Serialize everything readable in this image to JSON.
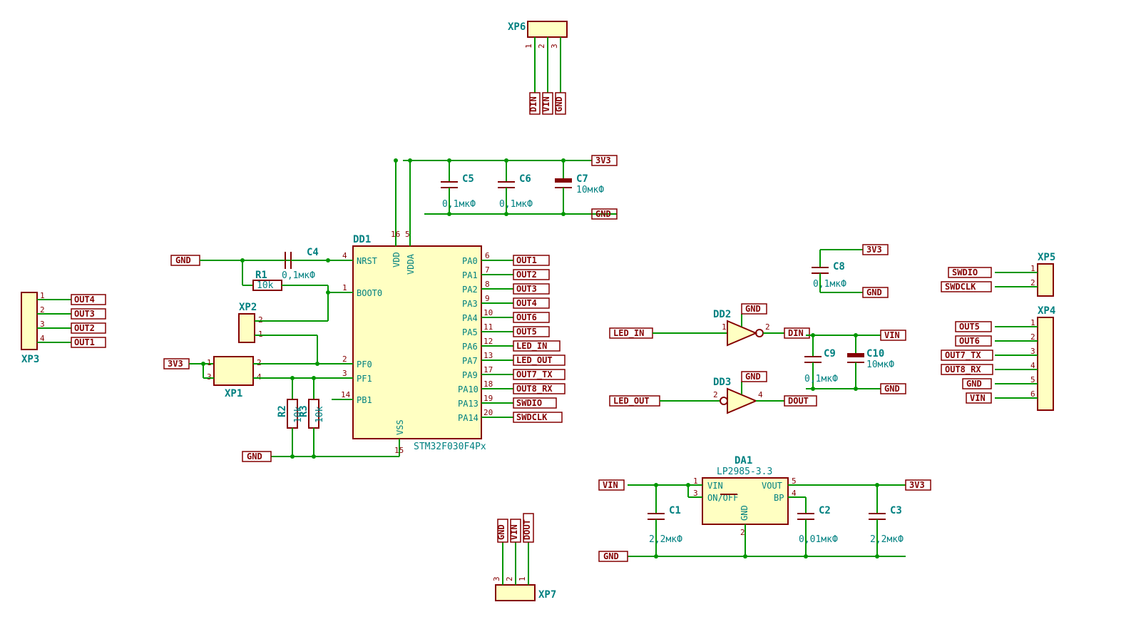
{
  "mcu": {
    "ref": "DD1",
    "value": "STM32F030F4Px",
    "left": [
      {
        "num": "4",
        "name": "NRST"
      },
      {
        "num": "1",
        "name": "BOOT0"
      },
      {
        "num": "2",
        "name": "PF0"
      },
      {
        "num": "3",
        "name": "PF1"
      },
      {
        "num": "14",
        "name": "PB1"
      }
    ],
    "right": [
      {
        "num": "6",
        "name": "PA0",
        "net": "OUT1"
      },
      {
        "num": "7",
        "name": "PA1",
        "net": "OUT2"
      },
      {
        "num": "8",
        "name": "PA2",
        "net": "OUT3"
      },
      {
        "num": "9",
        "name": "PA3",
        "net": "OUT4"
      },
      {
        "num": "10",
        "name": "PA4",
        "net": "OUT6"
      },
      {
        "num": "11",
        "name": "PA5",
        "net": "OUT5"
      },
      {
        "num": "12",
        "name": "PA6",
        "net": "LED_IN"
      },
      {
        "num": "13",
        "name": "PA7",
        "net": "LED_OUT"
      },
      {
        "num": "17",
        "name": "PA9",
        "net": "OUT7_TX"
      },
      {
        "num": "18",
        "name": "PA10",
        "net": "OUT8_RX"
      },
      {
        "num": "19",
        "name": "PA13",
        "net": "SWDIO"
      },
      {
        "num": "20",
        "name": "PA14",
        "net": "SWDCLK"
      }
    ],
    "top": [
      {
        "num": "16",
        "name": "VDD"
      },
      {
        "num": "5",
        "name": "VDDA"
      }
    ],
    "bot": [
      {
        "num": "15",
        "name": "VSS"
      }
    ]
  },
  "caps": {
    "c1": {
      "ref": "C1",
      "val": "2,2мкФ"
    },
    "c2": {
      "ref": "C2",
      "val": "0,01мкФ"
    },
    "c3": {
      "ref": "C3",
      "val": "2,2мкФ"
    },
    "c4": {
      "ref": "C4",
      "val": "0,1мкФ"
    },
    "c5": {
      "ref": "C5",
      "val": "0,1мкФ"
    },
    "c6": {
      "ref": "C6",
      "val": "0,1мкФ"
    },
    "c7": {
      "ref": "C7",
      "val": "10мкФ"
    },
    "c8": {
      "ref": "C8",
      "val": "0,1мкФ"
    },
    "c9": {
      "ref": "C9",
      "val": "0,1мкФ"
    },
    "c10": {
      "ref": "C10",
      "val": "10мкФ"
    }
  },
  "res": {
    "r1": {
      "ref": "R1",
      "val": "10k"
    },
    "r2": {
      "ref": "R2",
      "val": "10k"
    },
    "r3": {
      "ref": "R3",
      "val": "10k"
    }
  },
  "reg": {
    "ref": "DA1",
    "val": "LP2985-3.3",
    "pins": {
      "vin": "VIN",
      "onoff": "ON/OFF",
      "gnd": "GND",
      "bp": "BP",
      "vout": "VOUT",
      "p1": "1",
      "p3": "3",
      "p2": "2",
      "p4": "4",
      "p5": "5"
    }
  },
  "buf": {
    "dd2": "DD2",
    "dd3": "DD3"
  },
  "conn": {
    "xp1": "XP1",
    "xp2": "XP2",
    "xp3": "XP3",
    "xp4": "XP4",
    "xp5": "XP5",
    "xp6": "XP6",
    "xp7": "XP7"
  },
  "nets": {
    "gnd": "GND",
    "v3": "3V3",
    "vin": "VIN",
    "din": "DIN",
    "dout": "DOUT",
    "swdio": "SWDIO",
    "swdclk": "SWDCLK",
    "ledin": "LED_IN",
    "ledout": "LED_OUT",
    "out1": "OUT1",
    "out2": "OUT2",
    "out3": "OUT3",
    "out4": "OUT4",
    "out5": "OUT5",
    "out6": "OUT6",
    "out7": "OUT7_TX",
    "out8": "OUT8_RX"
  },
  "xp3pins": [
    "1",
    "2",
    "3",
    "4"
  ],
  "xp3nets": [
    "OUT4",
    "OUT3",
    "OUT2",
    "OUT1"
  ],
  "xp4pins": [
    "1",
    "2",
    "3",
    "4",
    "5",
    "6"
  ],
  "xp4nets": [
    "OUT5",
    "OUT6",
    "OUT7_TX",
    "OUT8_RX",
    "GND",
    "VIN"
  ],
  "xp5pins": [
    "1",
    "2"
  ],
  "xp5nets": [
    "SWDIO",
    "SWDCLK"
  ],
  "xp6pins": [
    "1",
    "2",
    "3"
  ],
  "xp6nets": [
    "DIN",
    "VIN",
    "GND"
  ],
  "xp7pins": [
    "3",
    "2",
    "1"
  ],
  "xp7nets": [
    "GND",
    "VIN",
    "DOUT"
  ]
}
